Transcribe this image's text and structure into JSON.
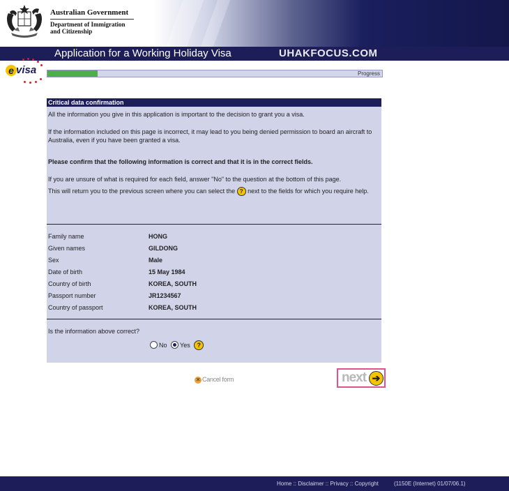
{
  "header": {
    "gov_title": "Australian Government",
    "dept_line1": "Department of Immigration",
    "dept_line2": "and Citizenship",
    "app_title": "Application for a Working Holiday Visa",
    "brand_watermark": "UHAKFOCUS.COM",
    "evisa_logo": "evisa"
  },
  "progress": {
    "label": "Progress",
    "fraction": 0.15
  },
  "panel": {
    "heading": "Critical data confirmation",
    "para1": "All the information you give in this application is important to the decision to grant you a visa.",
    "para2": "If the information included on this page is incorrect, it may lead to you being denied permission to board an aircraft to Australia, even if you have been granted a visa.",
    "para3": "Please confirm that the following information is correct and that it is in the correct fields.",
    "para4": "If you are unsure of what is required for each field, answer \"No\" to the question at the bottom of this page.",
    "para5_before": "This will return you to the previous screen where you can select the",
    "para5_after": "next to the fields for which you require help.",
    "help_glyph": "?"
  },
  "details": [
    {
      "label": "Family name",
      "value": "HONG"
    },
    {
      "label": "Given names",
      "value": "GILDONG"
    },
    {
      "label": "Sex",
      "value": "Male"
    },
    {
      "label": "Date of birth",
      "value": "15 May 1984"
    },
    {
      "label": "Country of birth",
      "value": "KOREA, SOUTH"
    },
    {
      "label": "Passport number",
      "value": "JR1234567"
    },
    {
      "label": "Country of passport",
      "value": "KOREA, SOUTH"
    }
  ],
  "question": {
    "text": "Is the information above correct?",
    "options": [
      {
        "label": "No",
        "selected": false
      },
      {
        "label": "Yes",
        "selected": true
      }
    ]
  },
  "actions": {
    "cancel_label": "Cancel form",
    "next_label": "next"
  },
  "footer": {
    "links": [
      "Home",
      "Disclaimer",
      "Privacy",
      "Copyright"
    ],
    "separator": " :: ",
    "version": "(1150E (Internet) 01/07/06.1)"
  },
  "colors": {
    "navy": "#1c1d59",
    "panel_bg": "#d1d3e9",
    "progress_fill": "#4caf4c",
    "help_yellow": "#f5c400",
    "next_highlight": "#e0518e"
  },
  "icons": [
    "coat-of-arms-icon",
    "help-icon",
    "cancel-icon",
    "next-arrow-icon",
    "radio-icon"
  ]
}
